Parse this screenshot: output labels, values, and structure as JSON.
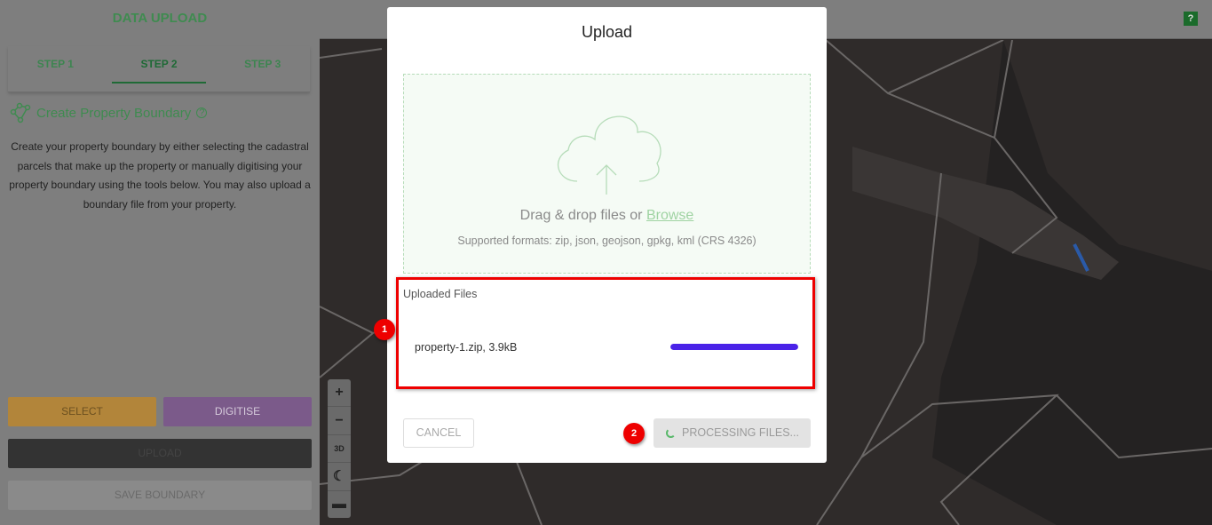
{
  "sidebar": {
    "title": "DATA UPLOAD",
    "tabs": [
      {
        "label": "STEP 1"
      },
      {
        "label": "STEP 2",
        "active": true
      },
      {
        "label": "STEP 3"
      }
    ],
    "section_title": "Create Property Boundary",
    "description": "Create your property boundary by either selecting the cadastral parcels that make up the property or manually digitising your property boundary using the tools below. You may also upload a boundary file from your property.",
    "buttons": {
      "select": "SELECT",
      "digitise": "DIGITISE",
      "upload": "UPLOAD",
      "save": "SAVE BOUNDARY"
    }
  },
  "topbar": {
    "help": "?"
  },
  "map_controls": {
    "zoom_in": "+",
    "zoom_out": "−",
    "three_d": "3D"
  },
  "modal": {
    "title": "Upload",
    "drop_text": "Drag & drop files or",
    "browse": "Browse",
    "formats": "Supported formats: zip, json, geojson, gpkg, kml (CRS 4326)",
    "uploaded_label": "Uploaded Files",
    "files": [
      {
        "name": "property-1.zip, 3.9kB",
        "progress": 1.0
      }
    ],
    "cancel": "CANCEL",
    "processing": "PROCESSING FILES..."
  },
  "annotations": [
    "1",
    "2"
  ],
  "colors": {
    "accent": "#3f8b50",
    "progress": "#4a22e8",
    "highlight": "#ee0000"
  }
}
